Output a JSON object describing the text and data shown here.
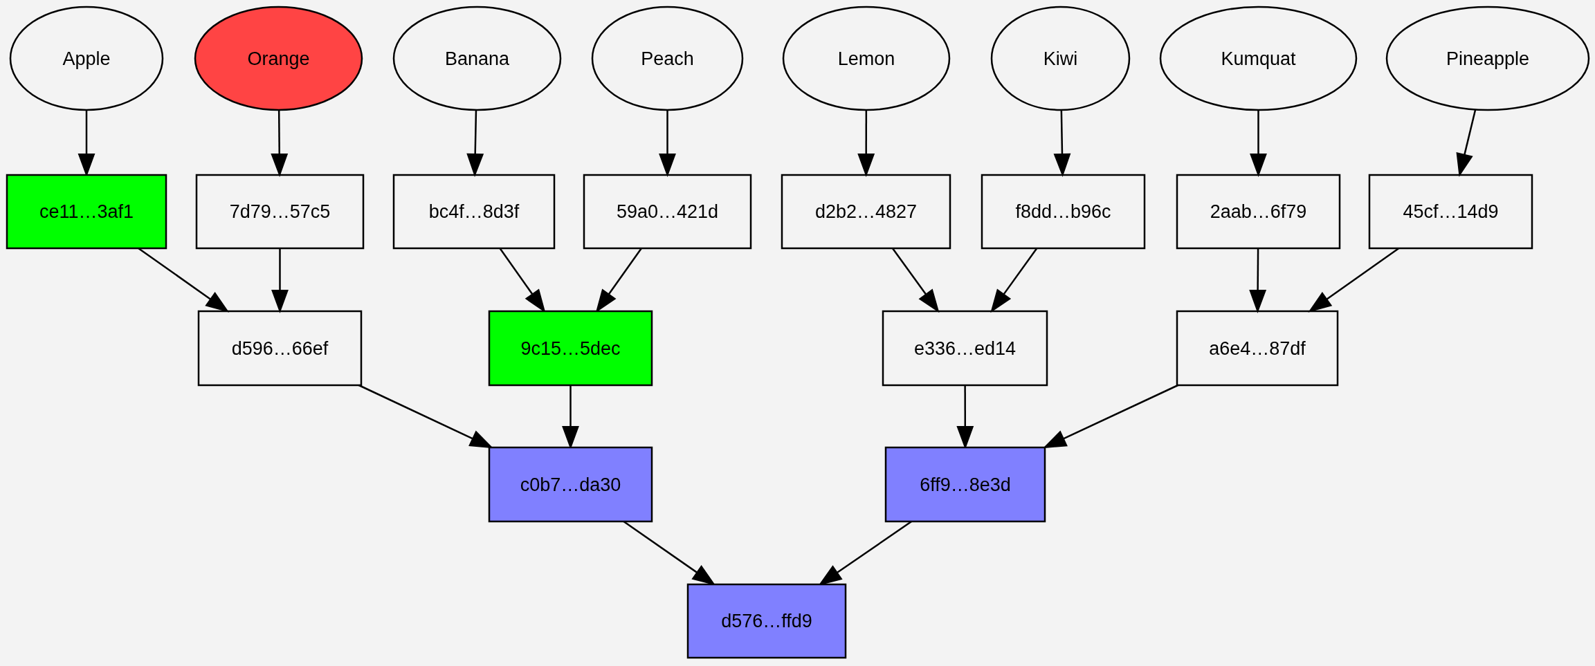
{
  "tree": {
    "label": "d576…ffd9",
    "kind": "box",
    "color": "#8080ff",
    "children": [
      {
        "label": "c0b7…da30",
        "kind": "box",
        "color": "#8080ff",
        "children": [
          {
            "label": "d596…66ef",
            "kind": "box",
            "children": [
              {
                "label": "ce11…3af1",
                "kind": "box",
                "color": "#00ff00",
                "children": [
                  {
                    "label": "Apple",
                    "kind": "ellipse"
                  }
                ]
              },
              {
                "label": "7d79…57c5",
                "kind": "box",
                "children": [
                  {
                    "label": "Orange",
                    "kind": "ellipse",
                    "color": "#ff4444"
                  }
                ]
              }
            ]
          },
          {
            "label": "9c15…5dec",
            "kind": "box",
            "color": "#00ff00",
            "children": [
              {
                "label": "bc4f…8d3f",
                "kind": "box",
                "children": [
                  {
                    "label": "Banana",
                    "kind": "ellipse"
                  }
                ]
              },
              {
                "label": "59a0…421d",
                "kind": "box",
                "children": [
                  {
                    "label": "Peach",
                    "kind": "ellipse"
                  }
                ]
              }
            ]
          }
        ]
      },
      {
        "label": "6ff9…8e3d",
        "kind": "box",
        "color": "#8080ff",
        "children": [
          {
            "label": "e336…ed14",
            "kind": "box",
            "children": [
              {
                "label": "d2b2…4827",
                "kind": "box",
                "children": [
                  {
                    "label": "Lemon",
                    "kind": "ellipse"
                  }
                ]
              },
              {
                "label": "f8dd…b96c",
                "kind": "box",
                "children": [
                  {
                    "label": "Kiwi",
                    "kind": "ellipse"
                  }
                ]
              }
            ]
          },
          {
            "label": "a6e4…87df",
            "kind": "box",
            "children": [
              {
                "label": "2aab…6f79",
                "kind": "box",
                "children": [
                  {
                    "label": "Kumquat",
                    "kind": "ellipse"
                  }
                ]
              },
              {
                "label": "45cf…14d9",
                "kind": "box",
                "children": [
                  {
                    "label": "Pineapple",
                    "kind": "ellipse"
                  }
                ]
              }
            ]
          }
        ]
      }
    ]
  }
}
